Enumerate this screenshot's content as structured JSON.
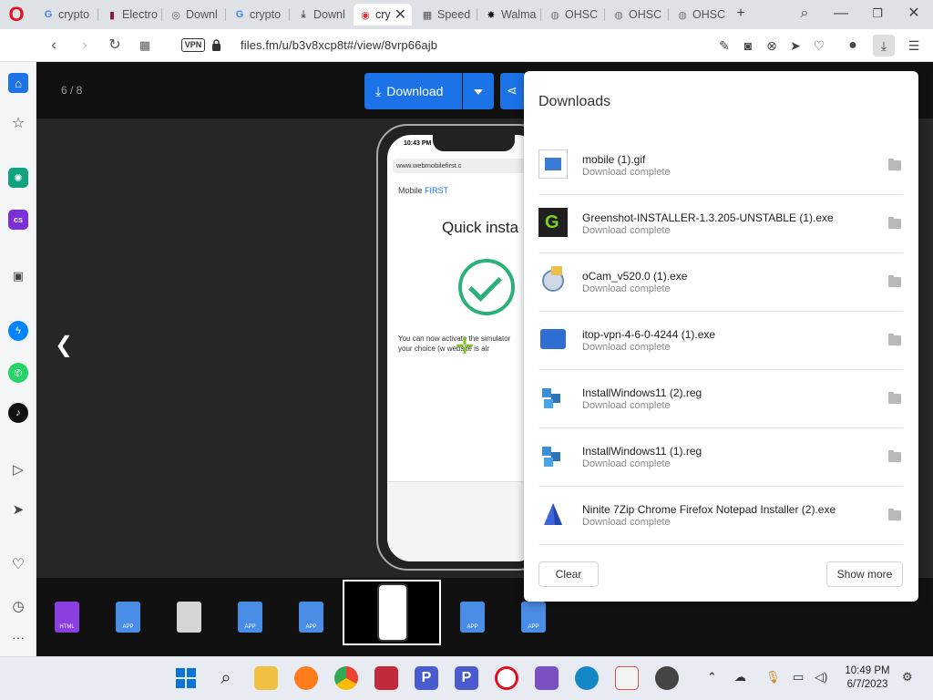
{
  "browser": {
    "tabs": [
      {
        "label": "crypto",
        "favicon": "google-icon"
      },
      {
        "label": "Electro",
        "favicon": "bookmark-icon"
      },
      {
        "label": "Downl",
        "favicon": "globe-icon"
      },
      {
        "label": "crypto",
        "favicon": "google-icon"
      },
      {
        "label": "Downl",
        "favicon": "download-icon"
      },
      {
        "label": "cry",
        "favicon": "camera-icon",
        "active": true
      },
      {
        "label": "Speed",
        "favicon": "grid-icon"
      },
      {
        "label": "Walma",
        "favicon": "walmart-icon"
      },
      {
        "label": "OHSC",
        "favicon": "ohsc-icon"
      },
      {
        "label": "OHSC",
        "favicon": "ohsc-icon"
      },
      {
        "label": "OHSC",
        "favicon": "ohsc-icon"
      }
    ],
    "vpn_label": "VPN",
    "url": "files.fm/u/b3v8xcp8t#/view/8vrp66ajb"
  },
  "viewer": {
    "page_counter": "6 / 8",
    "download_label": "Download",
    "phone": {
      "time": "10:43 PM",
      "url": "www.webmobilefirst.c",
      "brand_a": "Mobile",
      "brand_b": "FIRST",
      "title": "Quick insta",
      "text_line1": "You can now activate the simulator",
      "text_line2": "your choice (w    website is alr"
    },
    "thumbnails": [
      {
        "type": "html",
        "label": "HTML"
      },
      {
        "type": "app",
        "label": "APP"
      },
      {
        "type": "blank",
        "label": ""
      },
      {
        "type": "app",
        "label": "APP"
      },
      {
        "type": "app",
        "label": "APP"
      },
      {
        "type": "image",
        "label": ""
      },
      {
        "type": "app",
        "label": "APP"
      },
      {
        "type": "app",
        "label": "APP"
      }
    ]
  },
  "downloads": {
    "title": "Downloads",
    "items": [
      {
        "name": "mobile (1).gif",
        "status": "Download complete",
        "icon": "image-file-icon"
      },
      {
        "name": "Greenshot-INSTALLER-1.3.205-UNSTABLE (1).exe",
        "status": "Download complete",
        "icon": "greenshot-icon"
      },
      {
        "name": "oCam_v520.0 (1).exe",
        "status": "Download complete",
        "icon": "ocam-icon"
      },
      {
        "name": "itop-vpn-4-6-0-4244 (1).exe",
        "status": "Download complete",
        "icon": "itop-vpn-icon"
      },
      {
        "name": "InstallWindows11 (2).reg",
        "status": "Download complete",
        "icon": "registry-icon"
      },
      {
        "name": "InstallWindows11 (1).reg",
        "status": "Download complete",
        "icon": "registry-icon"
      },
      {
        "name": "Ninite 7Zip Chrome Firefox Notepad Installer (2).exe",
        "status": "Download complete",
        "icon": "ninite-icon"
      }
    ],
    "clear_label": "Clear",
    "show_more_label": "Show more"
  },
  "taskbar": {
    "time": "10:49 PM",
    "date": "6/7/2023"
  },
  "colors": {
    "accent_blue": "#1c73e8",
    "opera_red": "#e0101e",
    "success_green": "#2cb07a"
  }
}
